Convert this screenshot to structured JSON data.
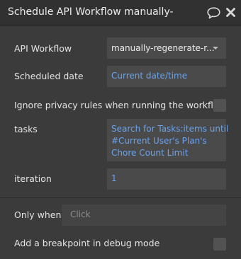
{
  "header": {
    "title": "Schedule API Workflow manually-",
    "comment_icon": "comment-icon",
    "close_icon": "close-icon"
  },
  "fields": {
    "api_workflow": {
      "label": "API Workflow",
      "value": "manually-regenerate-r..."
    },
    "scheduled_date": {
      "label": "Scheduled date",
      "value": "Current date/time"
    },
    "ignore_privacy": {
      "label": "Ignore privacy rules when running the workflow",
      "checked": false
    },
    "tasks": {
      "label": "tasks",
      "value_lines": [
        "Search for Tasks:items until",
        "#Current User's Plan's",
        "Chore Count Limit"
      ]
    },
    "iteration": {
      "label": "iteration",
      "value": "1"
    },
    "only_when": {
      "label": "Only when",
      "placeholder": "Click"
    },
    "breakpoint": {
      "label": "Add a breakpoint in debug mode",
      "checked": false
    }
  },
  "colors": {
    "panel_bg": "#3b3b3b",
    "header_bg": "#313131",
    "field_bg": "#4a4a4a",
    "dynamic_text": "#6aa3ee",
    "placeholder_text": "#8c8c8c"
  }
}
